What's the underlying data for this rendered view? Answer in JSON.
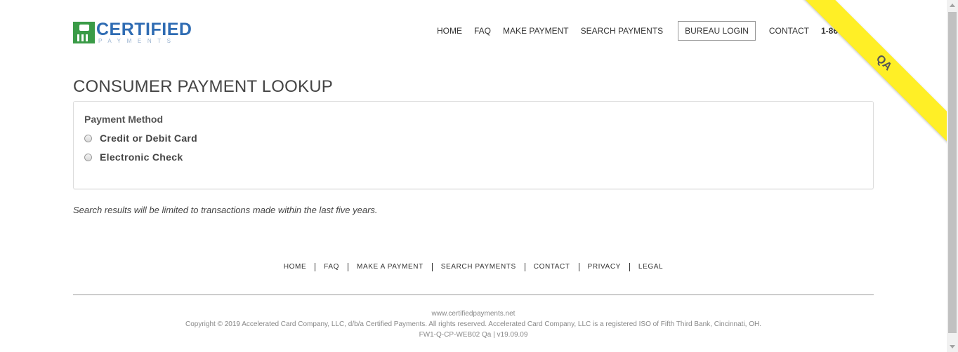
{
  "brand": {
    "name": "CERTIFIED",
    "subtitle": "PAYMENTS"
  },
  "header": {
    "nav": [
      {
        "label": "HOME"
      },
      {
        "label": "FAQ"
      },
      {
        "label": "MAKE PAYMENT"
      },
      {
        "label": "SEARCH PAYMENTS"
      },
      {
        "label": "BUREAU LOGIN"
      },
      {
        "label": "CONTACT"
      },
      {
        "label": "1-866-53"
      }
    ]
  },
  "ribbon": {
    "label": "QA",
    "color": "#ffef26"
  },
  "main": {
    "title": "CONSUMER PAYMENT LOOKUP",
    "payment_method": {
      "label": "Payment Method",
      "options": [
        {
          "label": "Credit or Debit Card",
          "selected": false
        },
        {
          "label": "Electronic Check",
          "selected": false
        }
      ]
    },
    "note": "Search results will be limited to transactions made within the last five years."
  },
  "footer": {
    "links": [
      {
        "label": "HOME"
      },
      {
        "label": "FAQ"
      },
      {
        "label": "MAKE A PAYMENT"
      },
      {
        "label": "SEARCH PAYMENTS"
      },
      {
        "label": "CONTACT"
      },
      {
        "label": "PRIVACY"
      },
      {
        "label": "LEGAL"
      }
    ],
    "site": "www.certifiedpayments.net",
    "copyright": "Copyright © 2019 Accelerated Card Company, LLC, d/b/a Certified Payments. All rights reserved. Accelerated Card Company, LLC is a registered ISO of Fifth Third Bank, Cincinnati, OH.",
    "build": "FW1-Q-CP-WEB02 Qa | v19.09.09"
  },
  "colors": {
    "brand_blue": "#2f6cb3",
    "brand_green": "#3a9b47"
  }
}
